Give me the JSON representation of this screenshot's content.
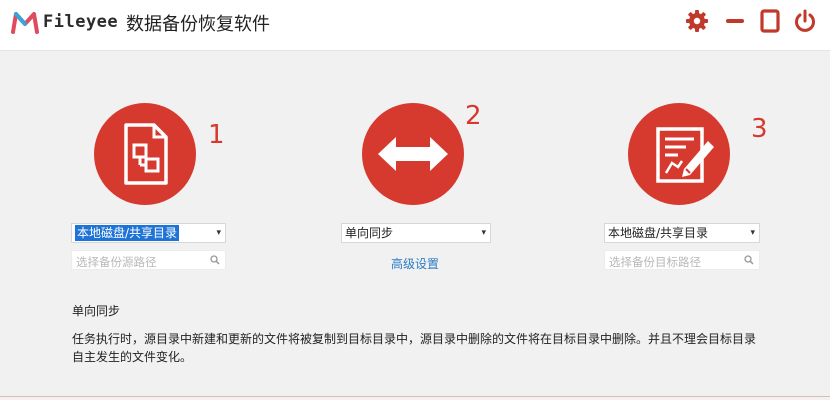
{
  "app": {
    "brand": "Fileyee",
    "title": "数据备份恢复软件"
  },
  "titlebar_icons": [
    "gear-icon",
    "minimize-icon",
    "maximize-icon",
    "power-icon"
  ],
  "steps": [
    {
      "number": "1",
      "icon": "document-icon"
    },
    {
      "number": "2",
      "icon": "double-arrow-icon"
    },
    {
      "number": "3",
      "icon": "edit-document-icon"
    }
  ],
  "source": {
    "select_value": "本地磁盘/共享目录",
    "search_placeholder": "选择备份源路径"
  },
  "middle": {
    "select_value": "单向同步",
    "advanced_link": "高级设置"
  },
  "target": {
    "select_value": "本地磁盘/共享目录",
    "search_placeholder": "选择备份目标路径"
  },
  "description": {
    "title": "单向同步",
    "text": "任务执行时，源目录中新建和更新的文件将被复制到目标目录中，源目录中删除的文件将在目标目录中删除。并且不理会目标目录自主发生的文件变化。"
  },
  "colors": {
    "accent": "#d63a2f",
    "link": "#2b7bc6",
    "selection": "#1e73d6"
  }
}
